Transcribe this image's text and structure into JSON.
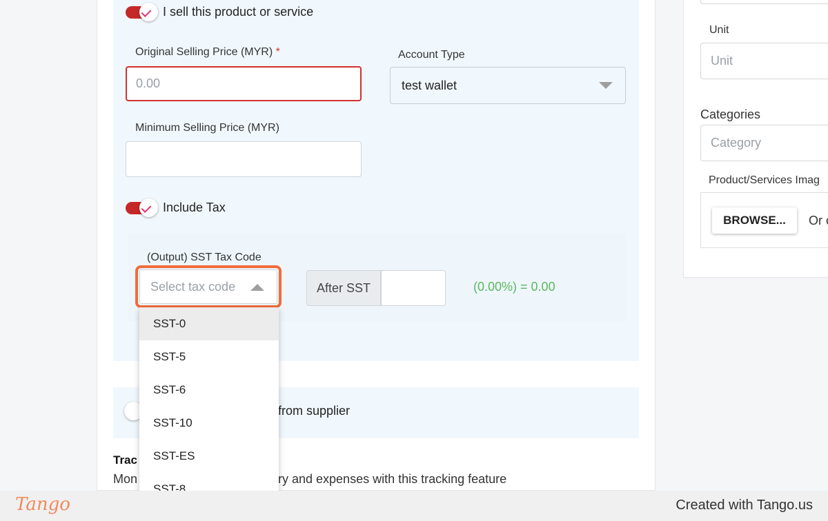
{
  "sell": {
    "toggle_label": "I sell this product or service",
    "original_price_label": "Original Selling Price (MYR)",
    "required_mark": "*",
    "original_price_placeholder": "0.00",
    "account_type_label": "Account Type",
    "account_type_value": "test wallet",
    "min_price_label": "Minimum Selling Price (MYR)",
    "min_price_value": "",
    "include_tax_label": "Include Tax",
    "tax_code_label": "(Output) SST Tax Code",
    "tax_code_placeholder": "Select tax code",
    "after_sst_label": "After SST",
    "tax_result": "(0.00%) = 0.00"
  },
  "tax_code_options": [
    "SST-0",
    "SST-5",
    "SST-6",
    "SST-10",
    "SST-ES",
    "SST-8"
  ],
  "buy": {
    "toggle_label_partial": "from supplier"
  },
  "tracking": {
    "heading_partial": "Trac",
    "desc_start": "Mon",
    "desc_end": "ry and expenses with this tracking feature"
  },
  "side": {
    "unit_label": "Unit",
    "unit_placeholder": "Unit",
    "categories_label": "Categories",
    "category_placeholder": "Category",
    "image_label": "Product/Services Imag",
    "browse_label": "BROWSE...",
    "or_text": "Or c"
  },
  "footer": {
    "logo": "Tango",
    "credit": "Created with Tango.us"
  },
  "colors": {
    "toggle_on": "#c62828",
    "error_border": "#d32f2f",
    "focus_ring": "#f26b3a",
    "success_text": "#5cb85c",
    "section_bg": "#f1f8fd"
  }
}
